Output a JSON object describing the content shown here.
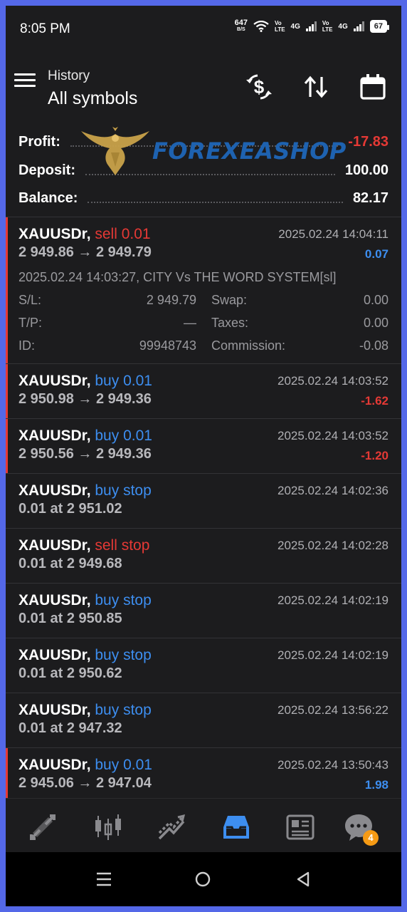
{
  "status_bar": {
    "time": "8:05 PM",
    "net_speed_value": "647",
    "net_speed_unit": "B/S",
    "lte1_a": "Vo",
    "lte1_b": "LTE",
    "sig1_label": "4G",
    "lte2_a": "Vo",
    "lte2_b": "LTE",
    "sig2_label": "4G",
    "battery": "67"
  },
  "header": {
    "subtitle": "History",
    "title": "All symbols",
    "actions": [
      "dollar-sync-icon",
      "sort-icon",
      "calendar-icon"
    ]
  },
  "watermark": {
    "text": "FOREXEASHOP",
    "emblem": "eagle-emblem"
  },
  "summary": {
    "profit_label": "Profit:",
    "profit_value": "-17.83",
    "deposit_label": "Deposit:",
    "deposit_value": "100.00",
    "balance_label": "Balance:",
    "balance_value": "82.17"
  },
  "deals": [
    {
      "symbol": "XAUUSDr,",
      "type": "sell 0.01",
      "side": "sell",
      "prices": "2 949.86 → 2 949.79",
      "time": "2025.02.24 14:04:11",
      "profit": "0.07",
      "profit_sign": "pos",
      "details": {
        "opened": "2025.02.24 14:03:27, CITY Vs THE WORD SYSTEM[sl]",
        "sl_label": "S/L:",
        "sl_value": "2 949.79",
        "tp_label": "T/P:",
        "tp_value": "—",
        "id_label": "ID:",
        "id_value": "99948743",
        "swap_label": "Swap:",
        "swap_value": "0.00",
        "taxes_label": "Taxes:",
        "taxes_value": "0.00",
        "commission_label": "Commission:",
        "commission_value": "-0.08"
      }
    },
    {
      "symbol": "XAUUSDr,",
      "type": "buy 0.01",
      "side": "buy",
      "prices": "2 950.98 → 2 949.36",
      "time": "2025.02.24 14:03:52",
      "profit": "-1.62",
      "profit_sign": "neg"
    },
    {
      "symbol": "XAUUSDr,",
      "type": "buy 0.01",
      "side": "buy",
      "prices": "2 950.56 → 2 949.36",
      "time": "2025.02.24 14:03:52",
      "profit": "-1.20",
      "profit_sign": "neg"
    },
    {
      "symbol": "XAUUSDr,",
      "type": "buy stop",
      "side": "buy",
      "prices": "0.01 at 2 951.02",
      "time": "2025.02.24 14:02:36"
    },
    {
      "symbol": "XAUUSDr,",
      "type": "sell stop",
      "side": "sell",
      "prices": "0.01 at 2 949.68",
      "time": "2025.02.24 14:02:28"
    },
    {
      "symbol": "XAUUSDr,",
      "type": "buy stop",
      "side": "buy",
      "prices": "0.01 at 2 950.85",
      "time": "2025.02.24 14:02:19"
    },
    {
      "symbol": "XAUUSDr,",
      "type": "buy stop",
      "side": "buy",
      "prices": "0.01 at 2 950.62",
      "time": "2025.02.24 14:02:19"
    },
    {
      "symbol": "XAUUSDr,",
      "type": "buy stop",
      "side": "buy",
      "prices": "0.01 at 2 947.32",
      "time": "2025.02.24 13:56:22"
    },
    {
      "symbol": "XAUUSDr,",
      "type": "buy 0.01",
      "side": "buy",
      "prices": "2 945.06 → 2 947.04",
      "time": "2025.02.24 13:50:43",
      "profit": "1.98",
      "profit_sign": "pos"
    }
  ],
  "bottom_nav": {
    "items": [
      "quotes-icon",
      "chart-icon",
      "trade-icon",
      "history-icon",
      "news-icon",
      "messages-icon"
    ],
    "active": "history-icon",
    "messages_badge": "4"
  },
  "colors": {
    "accent": "#3d8ef0",
    "loss": "#e53935",
    "background": "#1c1c1e",
    "badge": "#f59a14",
    "frame": "#5468e8"
  }
}
